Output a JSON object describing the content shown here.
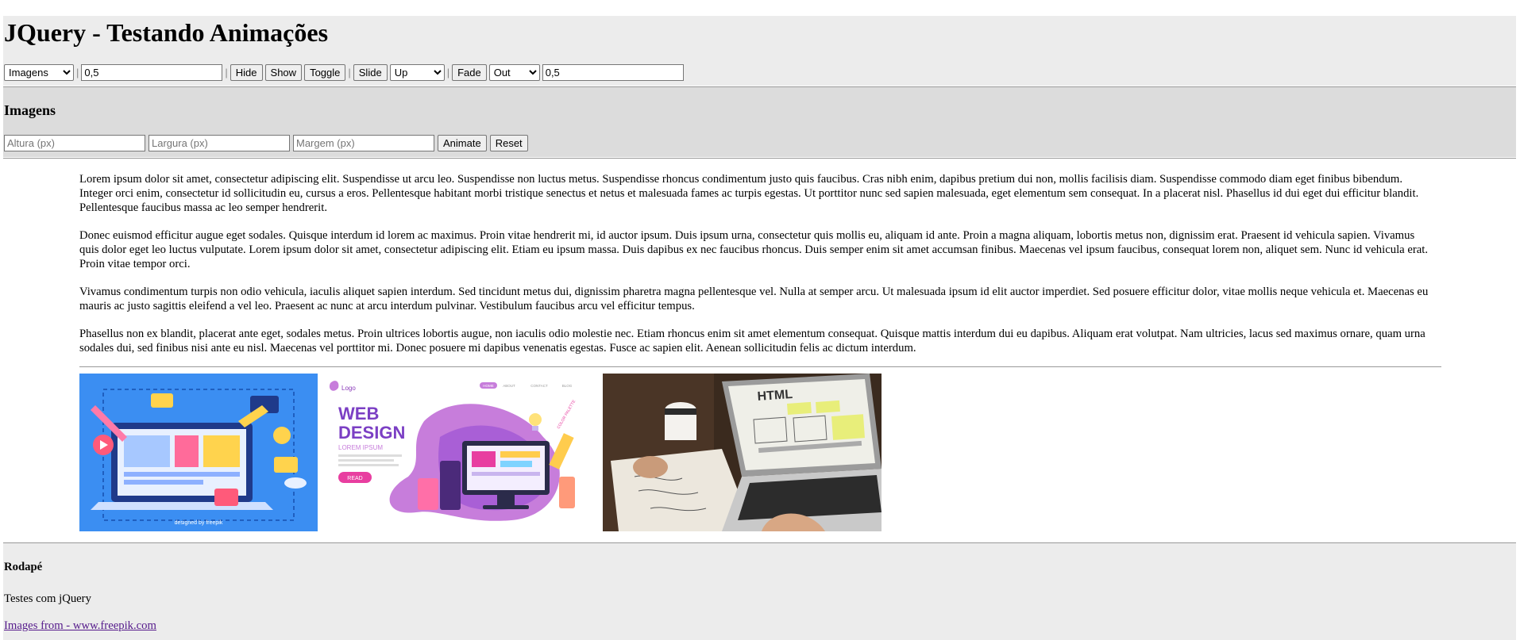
{
  "header": {
    "title": "JQuery - Testando Animações",
    "toolbar": {
      "target_select": "Imagens",
      "speed_value": "0,5",
      "hide_label": "Hide",
      "show_label": "Show",
      "toggle_label": "Toggle",
      "slide_label": "Slide",
      "slide_direction": "Up",
      "fade_label": "Fade",
      "fade_direction": "Out",
      "fade_value": "0,5",
      "separator": "|"
    }
  },
  "section": {
    "title": "Imagens",
    "height_placeholder": "Altura (px)",
    "width_placeholder": "Largura (px)",
    "margin_placeholder": "Margem (px)",
    "animate_label": "Animate",
    "reset_label": "Reset"
  },
  "content": {
    "paragraphs": [
      "Lorem ipsum dolor sit amet, consectetur adipiscing elit. Suspendisse ut arcu leo. Suspendisse non luctus metus. Suspendisse rhoncus condimentum justo quis faucibus. Cras nibh enim, dapibus pretium dui non, mollis facilisis diam. Suspendisse commodo diam eget finibus bibendum. Integer orci enim, consectetur id sollicitudin eu, cursus a eros. Pellentesque habitant morbi tristique senectus et netus et malesuada fames ac turpis egestas. Ut porttitor nunc sed sapien malesuada, eget elementum sem consequat. In a placerat nisl. Phasellus id dui eget dui efficitur blandit. Pellentesque faucibus massa ac leo semper hendrerit.",
      "Donec euismod efficitur augue eget sodales. Quisque interdum id lorem ac maximus. Proin vitae hendrerit mi, id auctor ipsum. Duis ipsum urna, consectetur quis mollis eu, aliquam id ante. Proin a magna aliquam, lobortis metus non, dignissim erat. Praesent id vehicula sapien. Vivamus quis dolor eget leo luctus vulputate. Lorem ipsum dolor sit amet, consectetur adipiscing elit. Etiam eu ipsum massa. Duis dapibus ex nec faucibus rhoncus. Duis semper enim sit amet accumsan finibus. Maecenas vel ipsum faucibus, consequat lorem non, aliquet sem. Nunc id vehicula erat. Proin vitae tempor orci.",
      "Vivamus condimentum turpis non odio vehicula, iaculis aliquet sapien interdum. Sed tincidunt metus dui, dignissim pharetra magna pellentesque vel. Nulla at semper arcu. Ut malesuada ipsum id elit auctor imperdiet. Sed posuere efficitur dolor, vitae mollis neque vehicula et. Maecenas eu mauris ac justo sagittis eleifend a vel leo. Praesent ac nunc at arcu interdum pulvinar. Vestibulum faucibus arcu vel efficitur tempus.",
      "Phasellus non ex blandit, placerat ante eget, sodales metus. Proin ultrices lobortis augue, non iaculis odio molestie nec. Etiam rhoncus enim sit amet elementum consequat. Quisque mattis interdum dui eu dapibus. Aliquam erat volutpat. Nam ultricies, lacus sed maximus ornare, quam urna sodales dui, sed finibus nisi ante eu nisl. Maecenas vel porttitor mi. Donec posuere mi dapibus venenatis egestas. Fusce ac sapien elit. Aenean sollicitudin felis ac dictum interdum."
    ],
    "images": {
      "img1_credit": "designed by freepik",
      "img2_logo": "Logo",
      "img2_title_1": "WEB",
      "img2_title_2": "DESIGN",
      "img2_sub": "LOREM IPSUM",
      "img2_button": "READ",
      "img2_nav": [
        "HOME",
        "ABOUT",
        "CONTACT",
        "BLOG"
      ],
      "img2_swatch": "COLOR PALETTE",
      "img3_text": "HTML"
    }
  },
  "footer": {
    "title": "Rodapé",
    "text": "Testes com jQuery",
    "link": "Images from - www.freepik.com"
  }
}
